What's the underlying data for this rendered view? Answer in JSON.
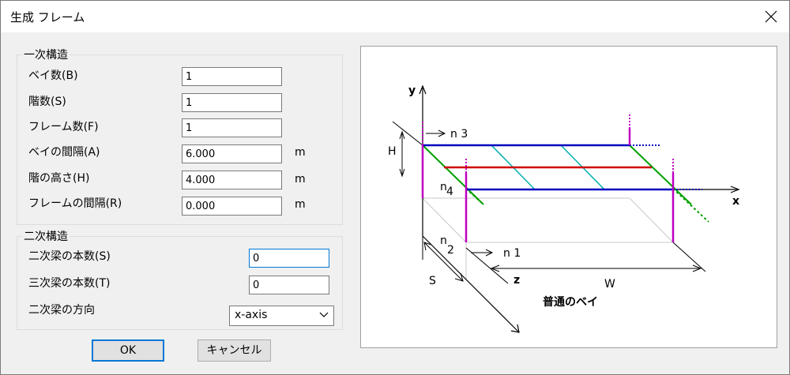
{
  "window": {
    "title": "生成 フレーム"
  },
  "primary": {
    "legend": "一次構造",
    "bays_label": "ベイ数(B)",
    "bays_value": "1",
    "stories_label": "階数(S)",
    "stories_value": "1",
    "frames_label": "フレーム数(F)",
    "frames_value": "1",
    "bay_spacing_label": "ベイの間隔(A)",
    "bay_spacing_value": "6.000",
    "bay_spacing_unit": "m",
    "story_height_label": "階の高さ(H)",
    "story_height_value": "4.000",
    "story_height_unit": "m",
    "frame_spacing_label": "フレームの間隔(R)",
    "frame_spacing_value": "0.000",
    "frame_spacing_unit": "m"
  },
  "secondary": {
    "legend": "二次構造",
    "secondary_beams_label": "二次梁の本数(S)",
    "secondary_beams_value": "0",
    "tertiary_beams_label": "三次梁の本数(T)",
    "tertiary_beams_value": "0",
    "direction_label": "二次梁の方向",
    "direction_value": "x-axis"
  },
  "buttons": {
    "ok": "OK",
    "cancel": "キャンセル"
  },
  "diagram": {
    "y_axis": "y",
    "x_axis": "x",
    "z_axis": "z",
    "h_label": "H",
    "s_label": "S",
    "w_label": "W",
    "n1": "n 1",
    "n2": "n",
    "n2_sub": "2",
    "n3": "n 3",
    "n4": "n",
    "n4_sub": "4",
    "caption": "普通のベイ",
    "colors": {
      "blue": "#0000c0",
      "red": "#d00000",
      "green": "#00a000",
      "cyan": "#00b0b0",
      "magenta": "#c000c0",
      "gray": "#c8c8c8"
    }
  }
}
